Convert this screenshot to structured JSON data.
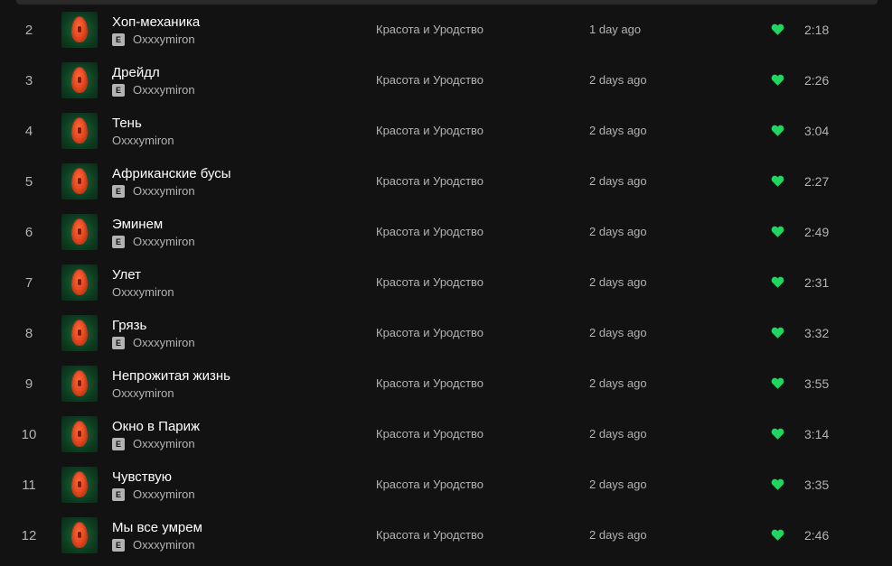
{
  "colors": {
    "background": "#121212",
    "text_primary": "#ffffff",
    "text_secondary": "#b3b3b3",
    "liked_heart": "#1ed760"
  },
  "icons": {
    "liked": "heart-filled-icon",
    "explicit": "explicit-badge"
  },
  "explicit_label": "E",
  "tracks": [
    {
      "num": "2",
      "title": "Хоп-механика",
      "explicit": true,
      "artist": "Oxxxymiron",
      "album": "Красота и Уродство",
      "added": "1 day ago",
      "liked": true,
      "duration": "2:18"
    },
    {
      "num": "3",
      "title": "Дрейдл",
      "explicit": true,
      "artist": "Oxxxymiron",
      "album": "Красота и Уродство",
      "added": "2 days ago",
      "liked": true,
      "duration": "2:26"
    },
    {
      "num": "4",
      "title": "Тень",
      "explicit": false,
      "artist": "Oxxxymiron",
      "album": "Красота и Уродство",
      "added": "2 days ago",
      "liked": true,
      "duration": "3:04"
    },
    {
      "num": "5",
      "title": "Африканские бусы",
      "explicit": true,
      "artist": "Oxxxymiron",
      "album": "Красота и Уродство",
      "added": "2 days ago",
      "liked": true,
      "duration": "2:27"
    },
    {
      "num": "6",
      "title": "Эминем",
      "explicit": true,
      "artist": "Oxxxymiron",
      "album": "Красота и Уродство",
      "added": "2 days ago",
      "liked": true,
      "duration": "2:49"
    },
    {
      "num": "7",
      "title": "Улет",
      "explicit": false,
      "artist": "Oxxxymiron",
      "album": "Красота и Уродство",
      "added": "2 days ago",
      "liked": true,
      "duration": "2:31"
    },
    {
      "num": "8",
      "title": "Грязь",
      "explicit": true,
      "artist": "Oxxxymiron",
      "album": "Красота и Уродство",
      "added": "2 days ago",
      "liked": true,
      "duration": "3:32"
    },
    {
      "num": "9",
      "title": "Непрожитая жизнь",
      "explicit": false,
      "artist": "Oxxxymiron",
      "album": "Красота и Уродство",
      "added": "2 days ago",
      "liked": true,
      "duration": "3:55"
    },
    {
      "num": "10",
      "title": "Окно в Париж",
      "explicit": true,
      "artist": "Oxxxymiron",
      "album": "Красота и Уродство",
      "added": "2 days ago",
      "liked": true,
      "duration": "3:14"
    },
    {
      "num": "11",
      "title": "Чувствую",
      "explicit": true,
      "artist": "Oxxxymiron",
      "album": "Красота и Уродство",
      "added": "2 days ago",
      "liked": true,
      "duration": "3:35"
    },
    {
      "num": "12",
      "title": "Мы все умрем",
      "explicit": true,
      "artist": "Oxxxymiron",
      "album": "Красота и Уродство",
      "added": "2 days ago",
      "liked": true,
      "duration": "2:46"
    }
  ]
}
